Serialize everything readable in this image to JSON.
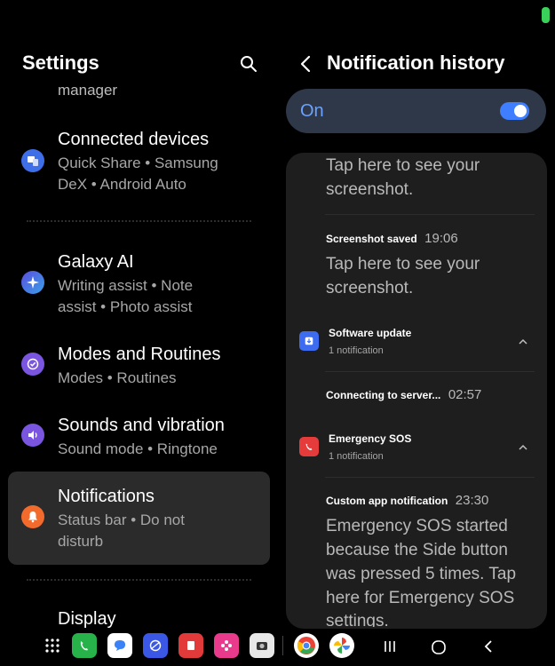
{
  "settings": {
    "title": "Settings",
    "partial_item": "manager",
    "items": [
      {
        "title": "Connected devices",
        "sub1": "Quick Share  •  Samsung",
        "sub2": "DeX  •  Android Auto",
        "icon": "connected-devices-icon",
        "color": "#3f6fe8"
      },
      {
        "title": "Galaxy AI",
        "sub1": "Writing assist  •  Note",
        "sub2": "assist  •  Photo assist",
        "icon": "galaxy-ai-icon",
        "color": "#4a72e6"
      },
      {
        "title": "Modes and Routines",
        "sub1": "Modes  •  Routines",
        "icon": "modes-routines-icon",
        "color": "#7a55e0"
      },
      {
        "title": "Sounds and vibration",
        "sub1": "Sound mode  •  Ringtone",
        "icon": "sound-icon",
        "color": "#7a55e0"
      },
      {
        "title": "Notifications",
        "sub1": "Status bar  •  Do not",
        "sub2": "disturb",
        "icon": "bell-icon",
        "color": "#f26b2d"
      },
      {
        "title": "Display",
        "icon": "display-icon"
      }
    ]
  },
  "notification_history": {
    "title": "Notification history",
    "toggle_label": "On",
    "toggle_on": true,
    "entries": {
      "partial_text_1": "Tap here to see your",
      "partial_text_2": "screenshot.",
      "screenshot_title": "Screenshot saved",
      "screenshot_time": "19:06",
      "screenshot_text_1": "Tap here to see your",
      "screenshot_text_2": "screenshot.",
      "software_group": "Software update",
      "software_count": "1 notification",
      "connecting_title": "Connecting to server...",
      "connecting_time": "02:57",
      "sos_group": "Emergency SOS",
      "sos_count": "1 notification",
      "custom_title": "Custom app notification",
      "custom_time": "23:30",
      "custom_text_1": "Emergency SOS started",
      "custom_text_2": "because the Side button",
      "custom_text_3": "was pressed 5 times. Tap",
      "custom_text_4": "here for Emergency SOS",
      "custom_text_5": "settings."
    }
  },
  "colors": {
    "accent_blue": "#3e7eff",
    "software_icon": "#3e6cf0",
    "sos_icon": "#e53b3b"
  }
}
